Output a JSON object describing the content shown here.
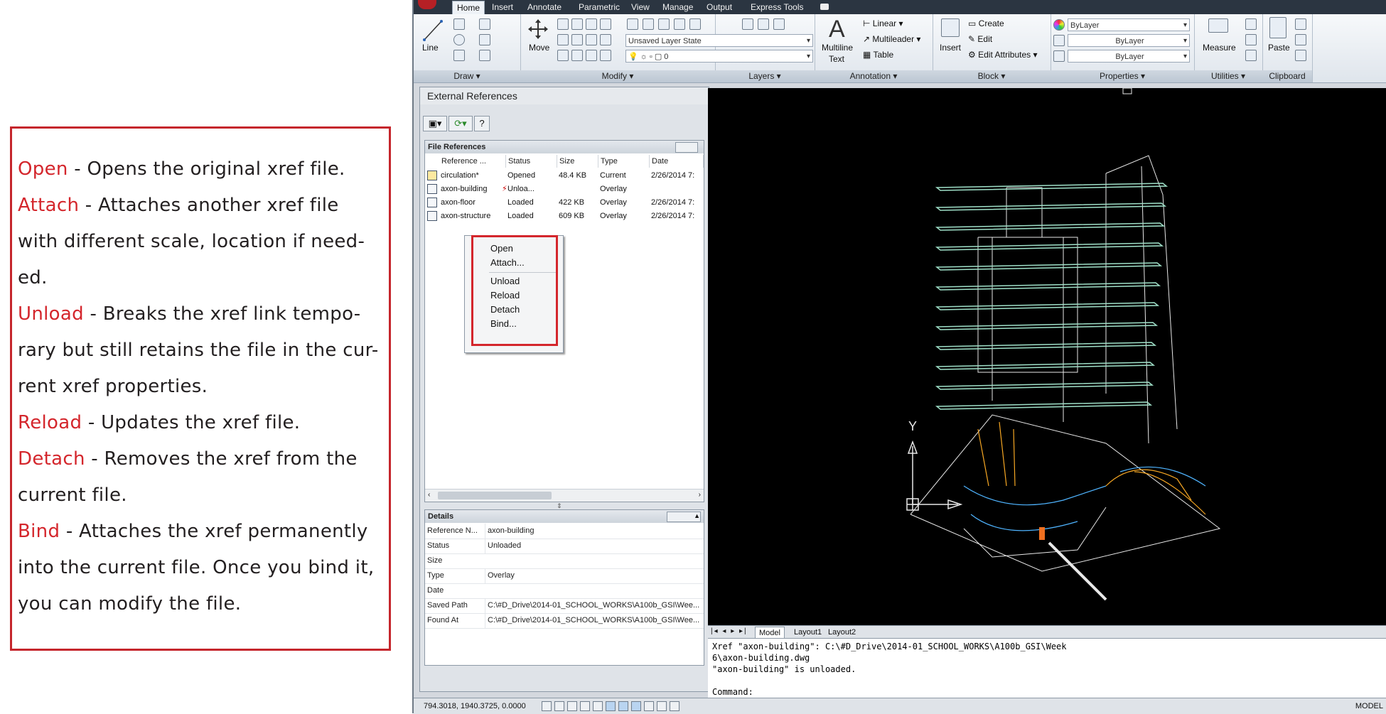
{
  "explanations": [
    {
      "term": "Open",
      "desc": " - Opens the original xref file."
    },
    {
      "term": "Attach",
      "desc": " - Attaches another xref file with different scale, location if need-ed."
    },
    {
      "term": "Unload",
      "desc": " - Breaks the xref link tempo-rary but still retains the file in the cur-rent xref properties."
    },
    {
      "term": "Reload",
      "desc": " - Updates the xref file."
    },
    {
      "term": "Detach",
      "desc": " - Removes the xref from the current file."
    },
    {
      "term": "Bind",
      "desc": " - Attaches the xref permanently into the current file. Once you bind it, you can modify the file."
    }
  ],
  "ribbon": {
    "tabs": [
      "Home",
      "Insert",
      "Annotate",
      "Parametric",
      "View",
      "Manage",
      "Output",
      "Express Tools"
    ],
    "active_tab": "Home",
    "panels": {
      "draw": "Draw ▾",
      "modify": "Modify ▾",
      "layers": "Layers ▾",
      "annotation": "Annotation ▾",
      "block": "Block ▾",
      "properties": "Properties ▾",
      "utilities": "Utilities ▾",
      "clipboard": "Clipboard"
    },
    "tools": {
      "line": "Line",
      "move": "Move",
      "layer_state": "Unsaved Layer State",
      "layer_current": "0",
      "multiline_text_1": "Multiline",
      "multiline_text_2": "Text",
      "linear": "Linear",
      "multileader": "Multileader",
      "table": "Table",
      "insert": "Insert",
      "create": "Create",
      "edit": "Edit",
      "edit_attributes": "Edit Attributes",
      "color": "ByLayer",
      "linetype": "ByLayer",
      "lineweight": "ByLayer",
      "measure": "Measure",
      "paste": "Paste"
    }
  },
  "xref": {
    "title": "External References",
    "file_refs_title": "File References",
    "columns": [
      "Reference ...",
      "Status",
      "Size",
      "Type",
      "Date"
    ],
    "rows": [
      {
        "name": "circulation*",
        "status": "Opened",
        "size": "48.4 KB",
        "type": "Current",
        "date": "2/26/2014 7:"
      },
      {
        "name": "axon-building",
        "status": "Unloa...",
        "size": "",
        "type": "Overlay",
        "date": ""
      },
      {
        "name": "axon-floor",
        "status": "Loaded",
        "size": "422 KB",
        "type": "Overlay",
        "date": "2/26/2014 7:"
      },
      {
        "name": "axon-structure",
        "status": "Loaded",
        "size": "609 KB",
        "type": "Overlay",
        "date": "2/26/2014 7:"
      }
    ],
    "context_menu": [
      "Open",
      "Attach...",
      "Unload",
      "Reload",
      "Detach",
      "Bind..."
    ],
    "details_title": "Details",
    "details": [
      {
        "key": "Reference N...",
        "value": "axon-building"
      },
      {
        "key": "Status",
        "value": "Unloaded"
      },
      {
        "key": "Size",
        "value": ""
      },
      {
        "key": "Type",
        "value": "Overlay"
      },
      {
        "key": "Date",
        "value": ""
      },
      {
        "key": "Saved Path",
        "value": "C:\\#D_Drive\\2014-01_SCHOOL_WORKS\\A100b_GSI\\Wee..."
      },
      {
        "key": "Found At",
        "value": "C:\\#D_Drive\\2014-01_SCHOOL_WORKS\\A100b_GSI\\Wee..."
      }
    ]
  },
  "layout_tabs": [
    "Model",
    "Layout1",
    "Layout2"
  ],
  "axis_label": "Y",
  "command_history": [
    "Xref \"axon-building\": C:\\#D_Drive\\2014-01_SCHOOL_WORKS\\A100b_GSI\\Week",
    "6\\axon-building.dwg",
    "\"axon-building\" is unloaded.",
    "",
    "Command:"
  ],
  "status": {
    "coords": "794.3018,  1940.3725, 0.0000",
    "model": "MODEL"
  }
}
